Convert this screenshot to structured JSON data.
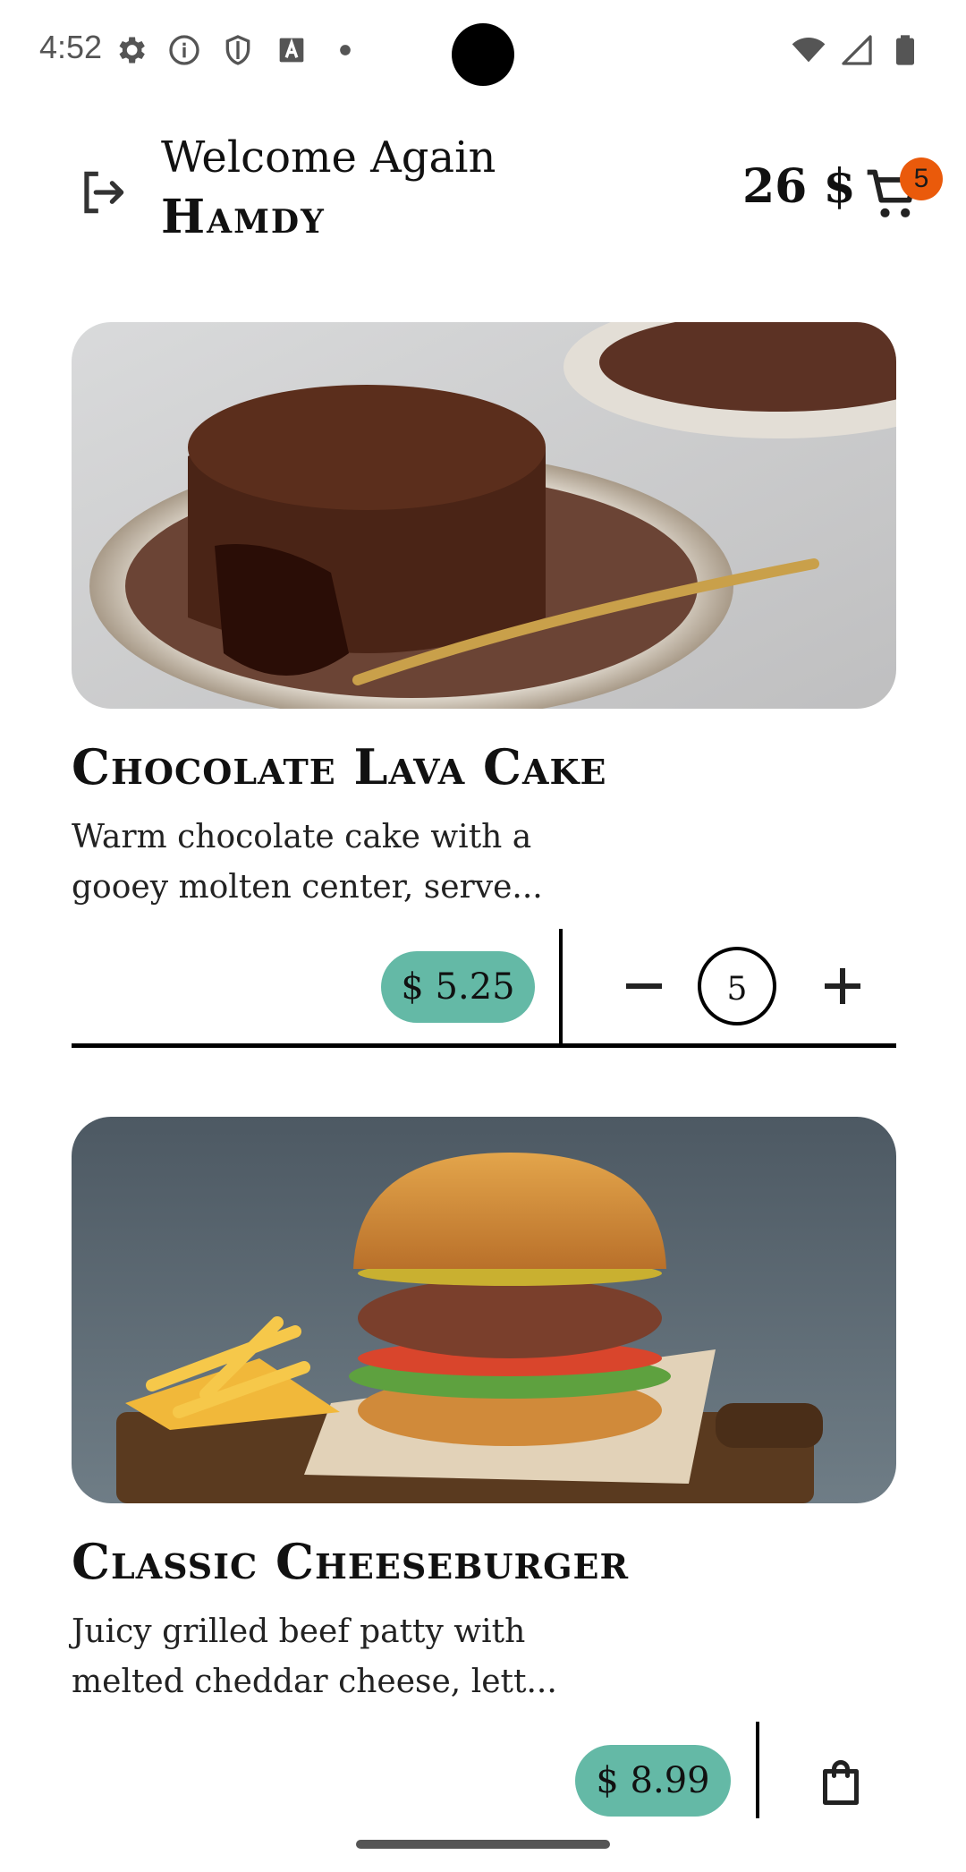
{
  "status_bar": {
    "time": "4:52",
    "left_icons": [
      "settings-icon",
      "info-icon",
      "shield-icon",
      "font-icon",
      "dot-icon"
    ],
    "right_icons": [
      "wifi-icon",
      "signal-icon",
      "battery-icon"
    ]
  },
  "header": {
    "welcome_text": "Welcome Again",
    "username": "Hamdy",
    "balance": "26 $",
    "cart_count": "5"
  },
  "products": [
    {
      "title": "Chocolate Lava Cake",
      "description": "Warm chocolate cake with a gooey molten center, serve...",
      "price": "$ 5.25",
      "quantity": "5"
    },
    {
      "title": "Classic Cheeseburger",
      "description": "Juicy grilled beef patty with melted cheddar cheese, lett...",
      "price": "$ 8.99"
    }
  ],
  "colors": {
    "accent": "#64b9a6",
    "badge": "#ea5a0b"
  }
}
